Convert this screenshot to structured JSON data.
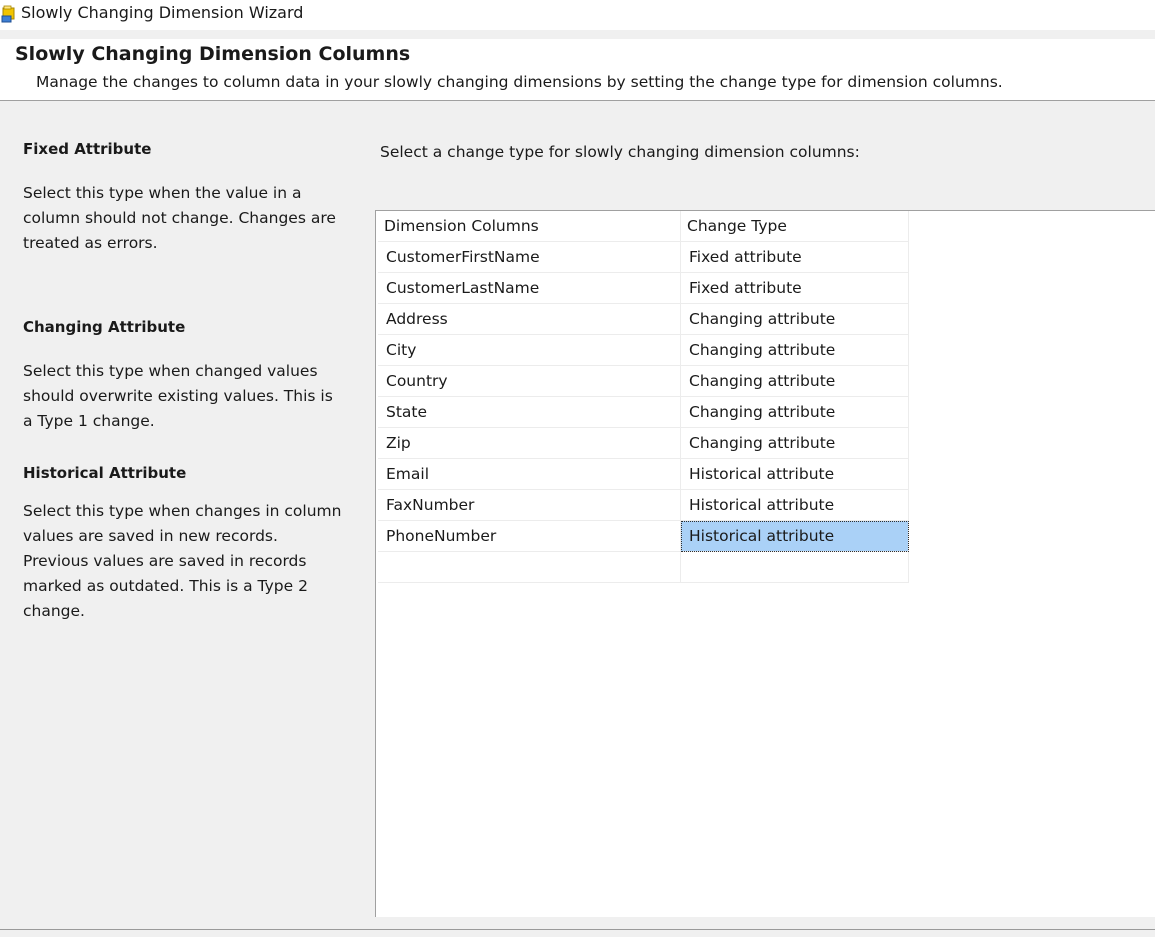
{
  "window": {
    "title": "Slowly Changing Dimension Wizard",
    "icon": "wizard-app-icon"
  },
  "header": {
    "title": "Slowly Changing Dimension Columns",
    "subtitle": "Manage the changes to column data in your slowly changing dimensions by setting the change type for dimension columns."
  },
  "descriptions": [
    {
      "title": "Fixed Attribute",
      "text": "Select this type when the value in a column should not change. Changes are treated as errors."
    },
    {
      "title": "Changing Attribute",
      "text": "Select this type when changed values should overwrite existing values. This is a Type 1 change."
    },
    {
      "title": "Historical Attribute",
      "text": "Select this type when changes in column values are saved in new records. Previous values are saved in records marked as outdated. This is a Type 2 change."
    }
  ],
  "instruction": "Select a change type for slowly changing dimension columns:",
  "grid": {
    "columns": [
      "Dimension Columns",
      "Change Type"
    ],
    "rows": [
      {
        "column": "CustomerFirstName",
        "change_type": "Fixed attribute"
      },
      {
        "column": "CustomerLastName",
        "change_type": "Fixed attribute"
      },
      {
        "column": "Address",
        "change_type": "Changing attribute"
      },
      {
        "column": "City",
        "change_type": "Changing attribute"
      },
      {
        "column": "Country",
        "change_type": "Changing attribute"
      },
      {
        "column": "State",
        "change_type": "Changing attribute"
      },
      {
        "column": "Zip",
        "change_type": "Changing attribute"
      },
      {
        "column": "Email",
        "change_type": "Historical attribute"
      },
      {
        "column": "FaxNumber",
        "change_type": "Historical attribute"
      },
      {
        "column": "PhoneNumber",
        "change_type": "Historical attribute"
      },
      {
        "column": "",
        "change_type": ""
      }
    ],
    "selected_row": 9
  },
  "colors": {
    "selection": "#aad1f7",
    "background": "#f0f0f0",
    "header_bg": "#ffffff"
  }
}
